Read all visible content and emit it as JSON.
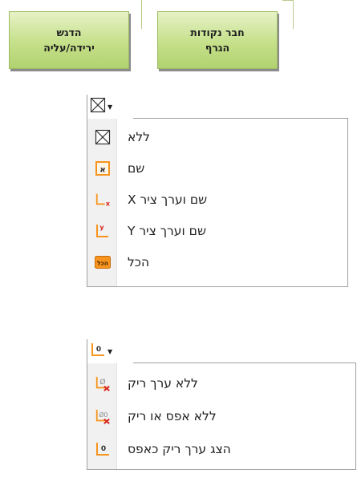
{
  "buttons": {
    "left": {
      "line1": "הדגש",
      "line2": "ירידה/עליה"
    },
    "right": {
      "line1": "חבר נקודות",
      "line2": "הגרף"
    }
  },
  "menu1": {
    "trigger_icon": "x-box-icon",
    "items": [
      {
        "label": "ללא",
        "icon": "x-box-icon"
      },
      {
        "label": "שם",
        "icon": "name-letter-icon",
        "icon_text": "א"
      },
      {
        "label": "שם וערך ציר X",
        "icon": "axis-x-value-icon",
        "icon_text": "x"
      },
      {
        "label": "שם וערך ציר Y",
        "icon": "axis-y-value-icon",
        "icon_text": "y"
      },
      {
        "label": "הכל",
        "icon": "all-badge-icon",
        "icon_text": "הכל"
      }
    ]
  },
  "menu2": {
    "trigger_icon": "zero-axis-icon",
    "trigger_text": "0",
    "items": [
      {
        "label": "ללא ערך ריק",
        "icon": "empty-value-delete-icon",
        "icon_text": "Ø"
      },
      {
        "label": "ללא אפס או ריק",
        "icon": "zero-or-empty-delete-icon",
        "icon_text": "Ø0"
      },
      {
        "label": "הצג ערך ריק כאפס",
        "icon": "show-empty-as-zero-icon",
        "icon_text": "0"
      }
    ]
  },
  "colors": {
    "button_green": "#c5e08a",
    "icon_orange": "#f7941d",
    "icon_red": "#d7261e"
  }
}
